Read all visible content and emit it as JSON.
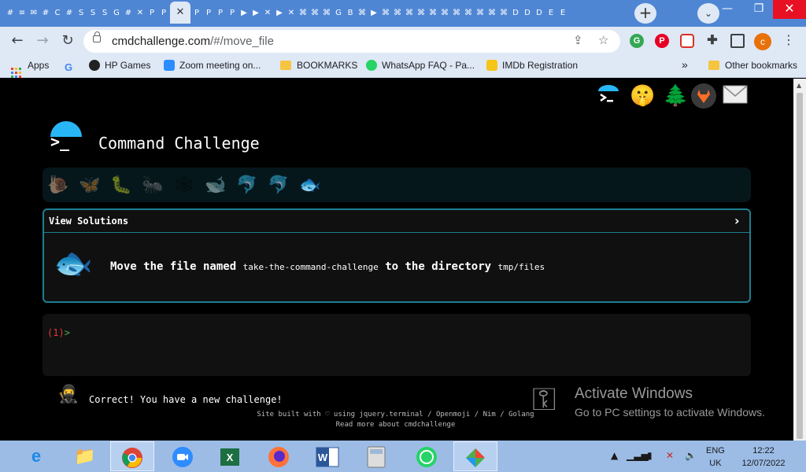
{
  "browser": {
    "url_host": "cmdchallenge.com",
    "url_path": "/#/move_file",
    "new_tab": "+",
    "tab_search": "⌄",
    "window_minimize": "—",
    "window_maximize": "❐",
    "window_close": "✕",
    "profile_initial": "c",
    "tabs_icons": [
      "#",
      "≡",
      "✉",
      "#",
      "C",
      "#",
      "S",
      "S",
      "S",
      "G",
      "#",
      "✕",
      "P",
      "P",
      "P",
      "P",
      "P",
      "P",
      "▶",
      "▶",
      "✕",
      "▶",
      "✕",
      "⌘",
      "⌘",
      "⌘",
      "G",
      "B",
      "⌘",
      "▶",
      "⌘",
      "⌘",
      "⌘",
      "⌘",
      "⌘",
      "⌘",
      "⌘",
      "⌘",
      "⌘",
      "⌘",
      "⌘",
      "D",
      "D",
      "D",
      "E",
      "E"
    ],
    "active_tab_icon": "✕"
  },
  "bookmarks": {
    "apps": "Apps",
    "items": [
      {
        "label": "HP Games"
      },
      {
        "label": "Zoom meeting on..."
      },
      {
        "label": "BOOKMARKS"
      },
      {
        "label": "WhatsApp FAQ - Pa..."
      },
      {
        "label": "IMDb Registration"
      }
    ],
    "more": "»",
    "other": "Other bookmarks"
  },
  "page": {
    "title": "Command Challenge",
    "logo_prompt": ">_",
    "top_icons": [
      "terminal-icon",
      "shushing-face-icon",
      "tree-icon",
      "gitlab-icon",
      "mail-icon"
    ],
    "levels": [
      "snail",
      "butterfly",
      "caterpillar",
      "ant",
      "spider-web",
      "whale",
      "dolphin",
      "dolphin-2",
      "fish"
    ],
    "card_header": "View Solutions",
    "card_chevron": "›",
    "challenge": {
      "prefix": "Move the file named",
      "filename": "take-the-command-challenge",
      "middle": "to the directory",
      "dir": "tmp/files"
    },
    "prompt_number": "(1)",
    "prompt_symbol": ">",
    "correct_message": "Correct! You have a new challenge!",
    "footer_line1": "Site built with ♡ using jquery.terminal / Openmoji / Nim / Golang",
    "footer_line2": "Read more about cmdchallenge"
  },
  "activate_windows": {
    "title": "Activate Windows",
    "subtitle": "Go to PC settings to activate Windows."
  },
  "taskbar": {
    "apps": [
      "internet-explorer",
      "file-explorer",
      "chrome",
      "zoom",
      "excel",
      "firefox",
      "word",
      "calculator",
      "whatsapp",
      "snipping-tool"
    ],
    "language": "ENG",
    "region": "UK",
    "time": "12:22",
    "date": "12/07/2022"
  }
}
